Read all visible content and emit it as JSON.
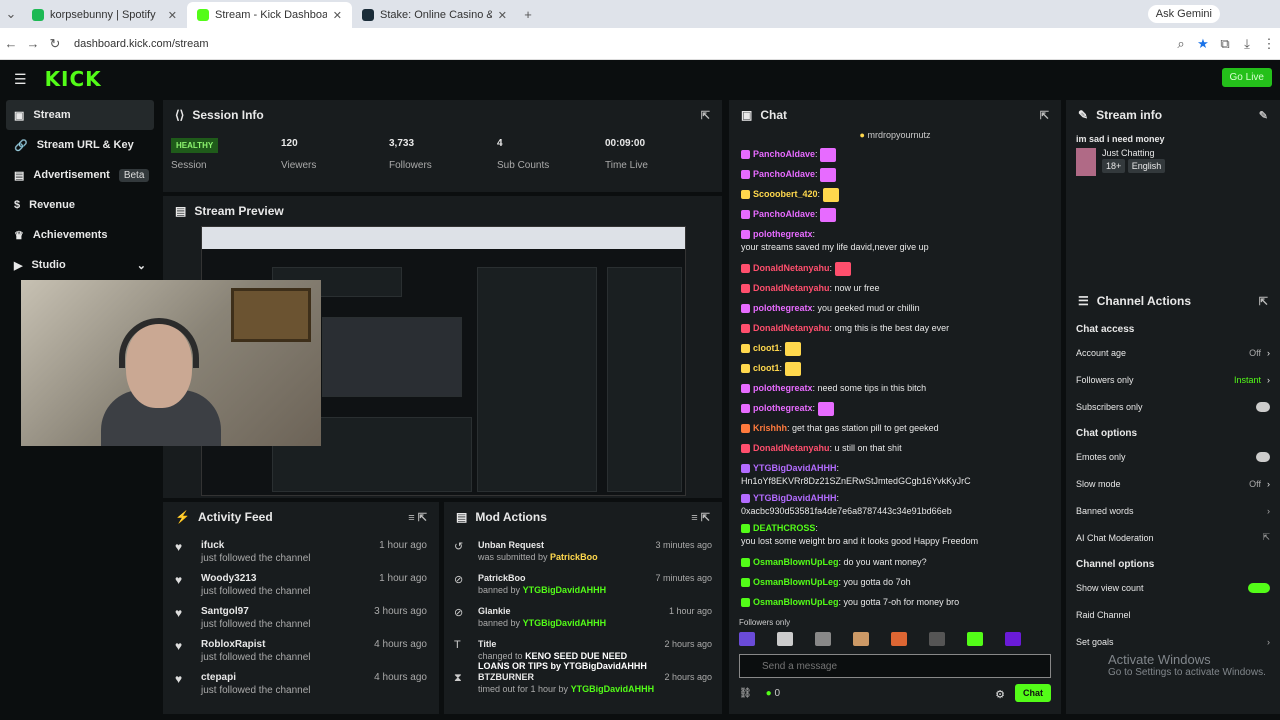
{
  "browser": {
    "tabs": [
      {
        "label": "korpsebunny | Spotify",
        "color": "#1db954"
      },
      {
        "label": "Stream - Kick Dashboard",
        "color": "#53fc18"
      },
      {
        "label": "Stake: Online Casino & Sports",
        "color": "#1a2c38"
      }
    ],
    "url": "dashboard.kick.com/stream",
    "gemini": "Ask Gemini"
  },
  "header": {
    "logo": "KICK",
    "go_live": "Go Live"
  },
  "sidebar": {
    "items": [
      {
        "label": "Stream",
        "icon": "camera-icon"
      },
      {
        "label": "Stream URL & Key",
        "icon": "link-icon"
      },
      {
        "label": "Advertisement",
        "icon": "ad-icon",
        "badge": "Beta"
      },
      {
        "label": "Revenue",
        "icon": "dollar-icon"
      },
      {
        "label": "Achievements",
        "icon": "trophy-icon"
      },
      {
        "label": "Studio",
        "icon": "video-icon"
      }
    ]
  },
  "session": {
    "title": "Session Info",
    "health": "HEALTHY",
    "stats": [
      {
        "value": "",
        "label": "Session"
      },
      {
        "value": "120",
        "label": "Viewers"
      },
      {
        "value": "3,733",
        "label": "Followers"
      },
      {
        "value": "4",
        "label": "Sub Counts"
      },
      {
        "value": "00:09:00",
        "label": "Time Live"
      }
    ]
  },
  "preview": {
    "title": "Stream Preview"
  },
  "activity": {
    "title": "Activity Feed",
    "items": [
      {
        "name": "ifuck",
        "sub": "just followed the channel",
        "time": "1 hour ago"
      },
      {
        "name": "Woody3213",
        "sub": "just followed the channel",
        "time": "1 hour ago"
      },
      {
        "name": "Santgol97",
        "sub": "just followed the channel",
        "time": "3 hours ago"
      },
      {
        "name": "RobloxRapist",
        "sub": "just followed the channel",
        "time": "4 hours ago"
      },
      {
        "name": "ctepapi",
        "sub": "just followed the channel",
        "time": "4 hours ago"
      }
    ]
  },
  "mod": {
    "title": "Mod Actions",
    "items": [
      {
        "name": "Unban Request",
        "pre": "was submitted by",
        "user": "PatrickBoo",
        "time": "3 minutes ago"
      },
      {
        "name": "PatrickBoo",
        "pre": "banned by",
        "user": "YTGBigDavidAHHH",
        "time": "7 minutes ago"
      },
      {
        "name": "Glankie",
        "pre": "banned by",
        "user": "YTGBigDavidAHHH",
        "time": "1 hour ago"
      },
      {
        "name": "Title",
        "pre": "changed to",
        "user": "KENO SEED DUE NEED LOANS OR TIPS by YTGBigDavidAHHH",
        "time": "2 hours ago"
      },
      {
        "name": "BTZBURNER",
        "pre": "timed out for 1 hour by",
        "user": "YTGBigDavidAHHH",
        "time": "2 hours ago"
      }
    ]
  },
  "chat": {
    "title": "Chat",
    "pinned": "mrdropyournutz",
    "messages": [
      {
        "user": "PanchoAldave",
        "color": "#e76bff",
        "text": ""
      },
      {
        "user": "PanchoAldave",
        "color": "#e76bff",
        "text": ""
      },
      {
        "user": "Scooobert_420",
        "color": "#ffd84d",
        "text": ""
      },
      {
        "user": "PanchoAldave",
        "color": "#e76bff",
        "text": ""
      },
      {
        "user": "polothegreatx",
        "color": "#e76bff",
        "text": "your streams saved my life david,never give up"
      },
      {
        "user": "DonaldNetanyahu",
        "color": "#ff4f6d",
        "text": ""
      },
      {
        "user": "DonaldNetanyahu",
        "color": "#ff4f6d",
        "text": "now ur free"
      },
      {
        "user": "polothegreatx",
        "color": "#e76bff",
        "text": "you geeked mud or chillin"
      },
      {
        "user": "DonaldNetanyahu",
        "color": "#ff4f6d",
        "text": "omg this is the best day ever"
      },
      {
        "user": "cloot1",
        "color": "#ffd84d",
        "text": ""
      },
      {
        "user": "cloot1",
        "color": "#ffd84d",
        "text": ""
      },
      {
        "user": "polothegreatx",
        "color": "#e76bff",
        "text": "need some tips in this bitch"
      },
      {
        "user": "polothegreatx",
        "color": "#e76bff",
        "text": ""
      },
      {
        "user": "Krishhh",
        "color": "#ff7a3d",
        "text": "get that gas station pill to get geeked"
      },
      {
        "user": "DonaldNetanyahu",
        "color": "#ff4f6d",
        "text": "u still on that shit"
      },
      {
        "user": "YTGBigDavidAHHH",
        "color": "#b36bff",
        "text": "Hn1oYf8EKVRr8Dz21SZnERwStJmtedGCgb16YvkKyJrC"
      },
      {
        "user": "YTGBigDavidAHHH",
        "color": "#b36bff",
        "text": "0xacbc930d53581fa4de7e6a8787443c34e91bd66eb"
      },
      {
        "user": "DEATHCROSS",
        "color": "#53fc18",
        "text": "you lost some weight bro and it looks good Happy Freedom"
      },
      {
        "user": "OsmanBlownUpLeg",
        "color": "#53fc18",
        "text": "do you want money?"
      },
      {
        "user": "OsmanBlownUpLeg",
        "color": "#53fc18",
        "text": "you gotta do 7oh"
      },
      {
        "user": "OsmanBlownUpLeg",
        "color": "#53fc18",
        "text": "you gotta 7-oh for money bro"
      }
    ],
    "followers_only": "Followers only",
    "input_placeholder": "Send a message",
    "count": "0",
    "send": "Chat"
  },
  "stream_info": {
    "title": "Stream info",
    "stream_title": "im sad i need money",
    "category": "Just Chatting",
    "age": "18+",
    "lang": "English"
  },
  "channel_actions": {
    "title": "Channel Actions",
    "sections": [
      {
        "name": "Chat access",
        "rows": [
          {
            "label": "Account age",
            "value": "Off"
          },
          {
            "label": "Followers only",
            "value": "Instant"
          },
          {
            "label": "Subscribers only",
            "value": ""
          }
        ]
      },
      {
        "name": "Chat options",
        "rows": [
          {
            "label": "Emotes only",
            "value": ""
          },
          {
            "label": "Slow mode",
            "value": "Off"
          },
          {
            "label": "Banned words",
            "value": ""
          },
          {
            "label": "AI Chat Moderation",
            "value": ""
          }
        ]
      },
      {
        "name": "Channel options",
        "rows": [
          {
            "label": "Show view count",
            "value": ""
          },
          {
            "label": "Raid Channel",
            "value": ""
          },
          {
            "label": "Set goals",
            "value": ""
          }
        ]
      }
    ]
  },
  "windows": {
    "line1": "Activate Windows",
    "line2": "Go to Settings to activate Windows."
  }
}
